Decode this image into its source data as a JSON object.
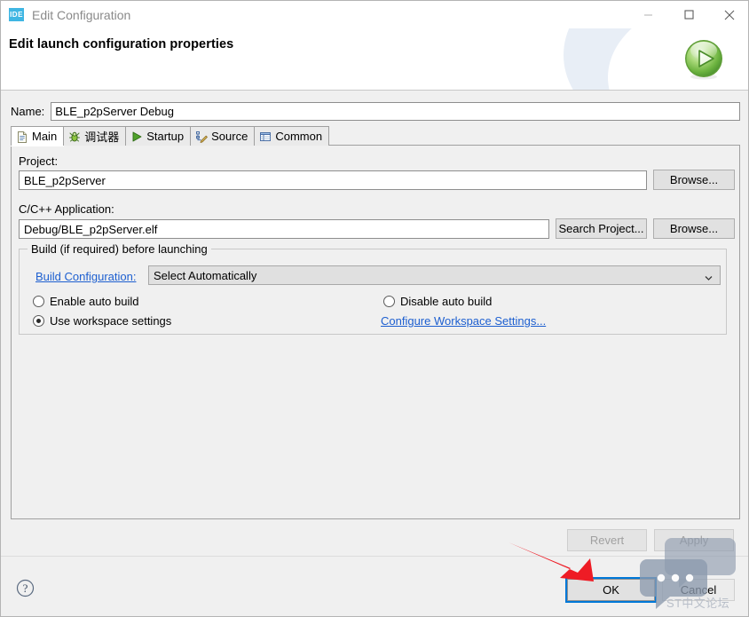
{
  "window": {
    "app_icon": "ide-icon",
    "title": "Edit Configuration",
    "minimize": "minimize-icon",
    "maximize": "maximize-icon",
    "close": "close-icon"
  },
  "banner": {
    "heading": "Edit launch configuration properties",
    "badge_icon": "run-play-icon"
  },
  "name_field": {
    "label": "Name:",
    "value": "BLE_p2pServer Debug"
  },
  "tabs": [
    {
      "label": "Main",
      "icon": "document-icon",
      "active": true
    },
    {
      "label": "调试器",
      "icon": "debugger-bug-icon",
      "active": false
    },
    {
      "label": "Startup",
      "icon": "green-play-icon",
      "active": false
    },
    {
      "label": "Source",
      "icon": "source-pencil-icon",
      "active": false
    },
    {
      "label": "Common",
      "icon": "common-table-icon",
      "active": false
    }
  ],
  "main_tab": {
    "project": {
      "label": "Project:",
      "value": "BLE_p2pServer",
      "browse_label": "Browse..."
    },
    "application": {
      "label": "C/C++ Application:",
      "value": "Debug/BLE_p2pServer.elf",
      "search_label": "Search Project...",
      "browse_label": "Browse..."
    },
    "build_group": {
      "title": "Build (if required) before launching",
      "build_configuration_label": "Build Configuration:",
      "build_configuration_value": "Select Automatically",
      "radios": [
        {
          "label": "Enable auto build",
          "checked": false
        },
        {
          "label": "Use workspace settings",
          "checked": true
        },
        {
          "label": "Disable auto build",
          "checked": false
        }
      ],
      "configure_link": "Configure Workspace Settings..."
    }
  },
  "footer": {
    "revert_label": "Revert",
    "apply_label": "Apply",
    "ok_label": "OK",
    "cancel_label": "Cancel",
    "help_icon": "help-question-icon"
  },
  "annotations": {
    "pointer_icon": "red-arrow-icon",
    "watermark_icon": "speech-bubbles-icon",
    "watermark_text": "ST中文论坛"
  },
  "colors": {
    "accent_blue": "#0078d7",
    "link_blue": "#1d5fd0",
    "ide_badge": "#3fb6e3",
    "arrow_red": "#ee1c25",
    "dialog_bg": "#f0f0f0"
  }
}
